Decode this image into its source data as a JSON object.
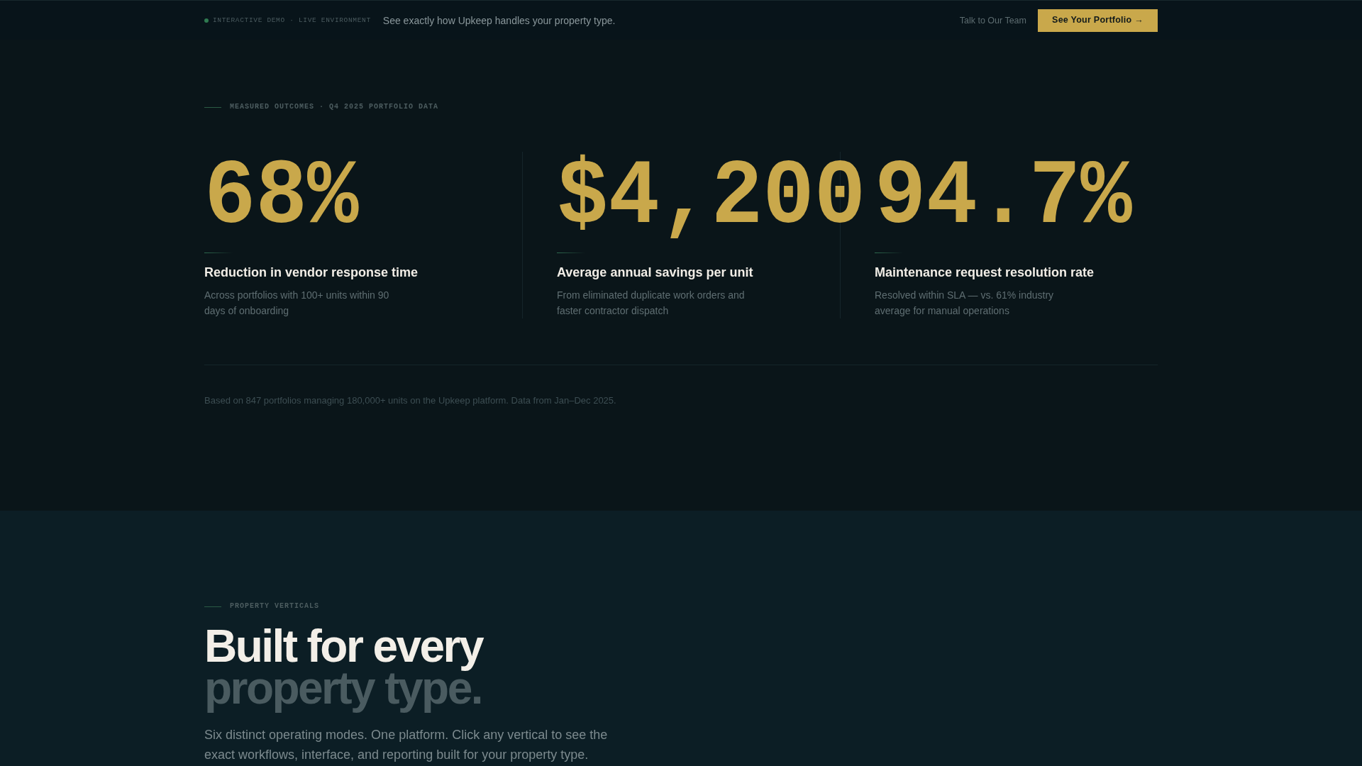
{
  "top_bar": {
    "badge": "INTERACTIVE DEMO · LIVE ENVIRONMENT",
    "tagline": "See exactly how Upkeep handles your property type.",
    "link": "Talk to Our Team",
    "cta": "See Your Portfolio →"
  },
  "outcomes": {
    "eyebrow": "MEASURED OUTCOMES · Q4 2025 PORTFOLIO DATA",
    "stats": [
      {
        "value": "68%",
        "title": "Reduction in vendor response time",
        "description": "Across portfolios with 100+ units within 90 days of onboarding"
      },
      {
        "value": "$4,200",
        "title": "Average annual savings per unit",
        "description": "From eliminated duplicate work orders and faster contractor dispatch"
      },
      {
        "value": "94.7%",
        "title": "Maintenance request resolution rate",
        "description": "Resolved within SLA — vs. 61% industry average for manual operations"
      }
    ],
    "footnote": "Based on 847 portfolios managing 180,000+ units on the Upkeep platform. Data from Jan–Dec 2025."
  },
  "verticals": {
    "eyebrow": "PROPERTY VERTICALS",
    "heading_lines": [
      "Built for every",
      "property type."
    ],
    "intro": "Six distinct operating modes. One platform. Click any vertical to see the exact workflows, interface, and reporting built for your property type."
  }
}
